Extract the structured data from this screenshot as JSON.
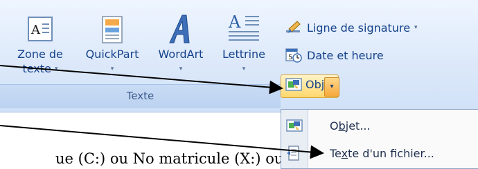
{
  "ribbon": {
    "group_label": "Texte",
    "buttons": {
      "zone_de_texte": {
        "line1": "Zone de",
        "line2": "texte"
      },
      "quickpart": {
        "label": "QuickPart"
      },
      "wordart": {
        "label": "WordArt"
      },
      "lettrine": {
        "label": "Lettrine"
      }
    },
    "small_buttons": {
      "ligne_signature": {
        "label": "Ligne de signature"
      },
      "date_heure": {
        "label": "Date et heure"
      },
      "objet": {
        "label": "Objet"
      }
    },
    "dropdown_glyph": "▾"
  },
  "menu": {
    "items": [
      {
        "pre": "O",
        "ul": "b",
        "post": "jet..."
      },
      {
        "pre": "Te",
        "ul": "x",
        "post": "te d'un fichier..."
      }
    ]
  },
  "document": {
    "partial_text": "ue (C:) ou No matricule (X:) ou"
  },
  "colors": {
    "ribbon_text": "#15428b",
    "hover_orange": "#ffd76c",
    "arrow": "#000000"
  }
}
